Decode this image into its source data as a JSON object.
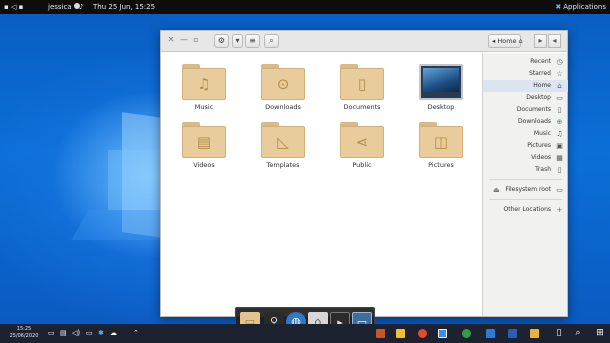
{
  "top_panel": {
    "applications_label": "Applications",
    "clock": "Thu 25 Jun, 15:25",
    "user": "jessica",
    "tray": "▪ ◁ ▪"
  },
  "window": {
    "path_label": "Home",
    "items": [
      {
        "label": "Desktop",
        "icon": "desktop-icon",
        "glyph": ""
      },
      {
        "label": "Documents",
        "icon": "document-icon",
        "glyph": "▯"
      },
      {
        "label": "Downloads",
        "icon": "download-icon",
        "glyph": "⊙"
      },
      {
        "label": "Music",
        "icon": "music-note-icon",
        "glyph": "♫"
      },
      {
        "label": "Pictures",
        "icon": "camera-icon",
        "glyph": "◫"
      },
      {
        "label": "Public",
        "icon": "share-icon",
        "glyph": "⋖"
      },
      {
        "label": "Templates",
        "icon": "ruler-triangle-icon",
        "glyph": "◺"
      },
      {
        "label": "Videos",
        "icon": "film-icon",
        "glyph": "▤"
      }
    ]
  },
  "sidebar": {
    "items": [
      {
        "label": "Recent",
        "icon": "clock-icon",
        "glyph": "◷"
      },
      {
        "label": "Starred",
        "icon": "star-icon",
        "glyph": "☆"
      },
      {
        "label": "Home",
        "icon": "home-icon",
        "glyph": "⌂"
      },
      {
        "label": "Desktop",
        "icon": "desktop-icon",
        "glyph": "▭"
      },
      {
        "label": "Documents",
        "icon": "document-icon",
        "glyph": "▯"
      },
      {
        "label": "Downloads",
        "icon": "download-icon",
        "glyph": "⊕"
      },
      {
        "label": "Music",
        "icon": "music-icon",
        "glyph": "♫"
      },
      {
        "label": "Pictures",
        "icon": "pictures-icon",
        "glyph": "▣"
      },
      {
        "label": "Videos",
        "icon": "videos-icon",
        "glyph": "▦"
      },
      {
        "label": "Trash",
        "icon": "trash-icon",
        "glyph": "▯"
      },
      {
        "label": "Filesystem root",
        "icon": "drive-icon",
        "glyph": "▭"
      },
      {
        "label": "Other Locations",
        "icon": "plus-icon",
        "glyph": "+"
      }
    ]
  },
  "taskbar": {
    "time": "15:25",
    "date": "25/06/2020"
  },
  "colors": {
    "folder": "#e8cc9c",
    "accent": "#0a64c8"
  }
}
